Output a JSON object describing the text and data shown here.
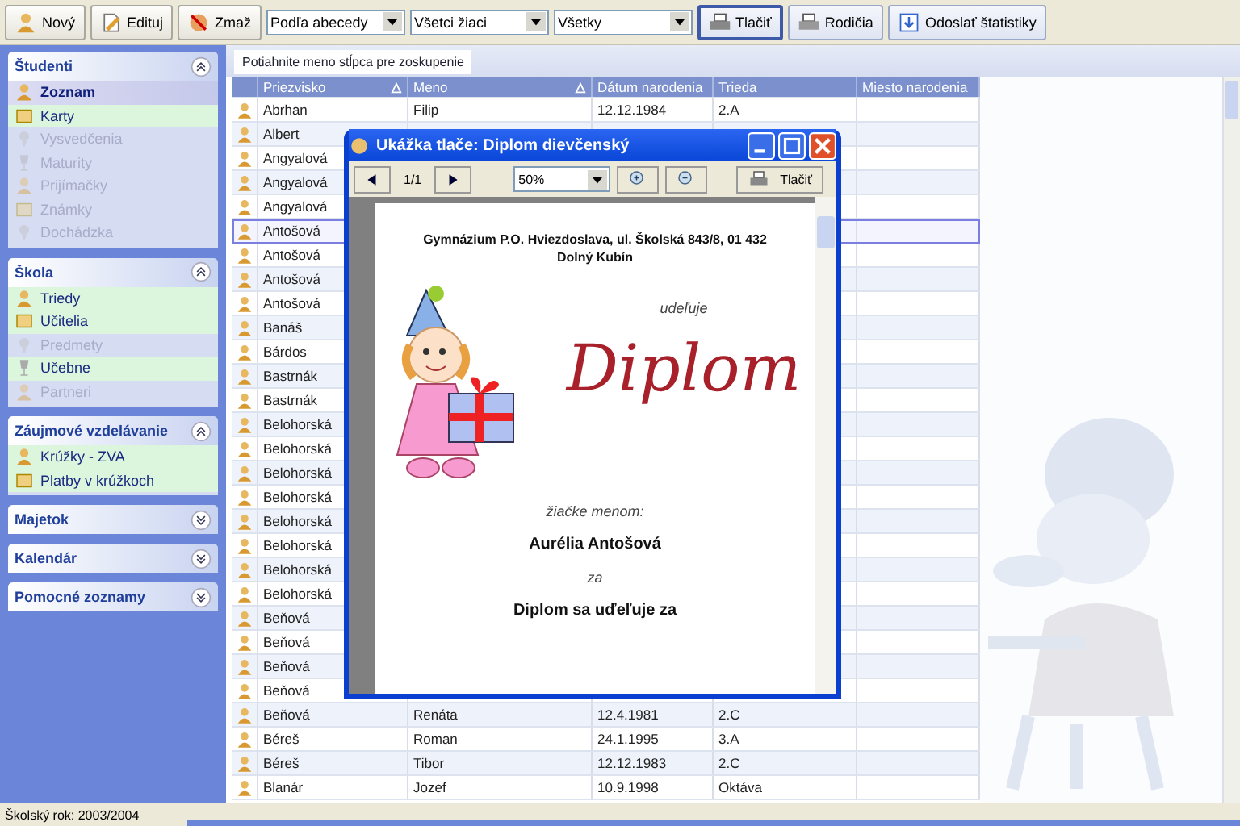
{
  "toolbar": {
    "buttons": [
      {
        "label": "Nový",
        "kind": "new"
      },
      {
        "label": "Edituj",
        "kind": "edit"
      },
      {
        "label": "Zmaž",
        "kind": "delete"
      }
    ],
    "dropdowns": [
      {
        "value": "Podľa abecedy"
      },
      {
        "value": "Všetci žiaci"
      },
      {
        "value": "Všetky"
      }
    ],
    "actions": [
      {
        "label": "Tlačiť",
        "kind": "print",
        "selected": true
      },
      {
        "label": "Rodičia",
        "kind": "parents",
        "selected": false
      },
      {
        "label": "Odoslať štatistiky",
        "kind": "stats",
        "selected": false
      }
    ]
  },
  "sidebar": {
    "panels": [
      {
        "title": "Študenti",
        "expanded": true,
        "items": [
          {
            "label": "Zoznam",
            "selected": true,
            "disabled": false
          },
          {
            "label": "Karty",
            "selected": false,
            "disabled": false
          },
          {
            "label": "Vysvedčenia",
            "selected": false,
            "disabled": true
          },
          {
            "label": "Maturity",
            "selected": false,
            "disabled": true
          },
          {
            "label": "Prijímačky",
            "selected": false,
            "disabled": true
          },
          {
            "label": "Známky",
            "selected": false,
            "disabled": true
          },
          {
            "label": "Dochádzka",
            "selected": false,
            "disabled": true
          }
        ]
      },
      {
        "title": "Škola",
        "expanded": true,
        "items": [
          {
            "label": "Triedy",
            "selected": false,
            "disabled": false
          },
          {
            "label": "Učitelia",
            "selected": false,
            "disabled": false
          },
          {
            "label": "Predmety",
            "selected": false,
            "disabled": true
          },
          {
            "label": "Učebne",
            "selected": false,
            "disabled": false
          },
          {
            "label": "Partneri",
            "selected": false,
            "disabled": true
          }
        ]
      },
      {
        "title": "Záujmové vzdelávanie",
        "expanded": true,
        "items": [
          {
            "label": "Krúžky - ZVA",
            "selected": false,
            "disabled": false
          },
          {
            "label": "Platby v krúžkoch",
            "selected": false,
            "disabled": false
          }
        ]
      },
      {
        "title": "Majetok",
        "expanded": false
      },
      {
        "title": "Kalendár",
        "expanded": false
      },
      {
        "title": "Pomocné zoznamy",
        "expanded": false
      }
    ]
  },
  "group_panel": {
    "hint": "Potiahnite meno stĺpca pre zoskupenie"
  },
  "table": {
    "columns": [
      {
        "label": "Priezvisko",
        "sorted": true
      },
      {
        "label": "Meno",
        "sorted": true
      },
      {
        "label": "Dátum narodenia",
        "sorted": false
      },
      {
        "label": "Trieda",
        "sorted": false
      },
      {
        "label": "Miesto narodenia",
        "sorted": false
      }
    ],
    "rows": [
      {
        "surname": "Abrhan",
        "name": "Filip",
        "birth_date": "12.12.1984",
        "class": "2.A",
        "selected": false
      },
      {
        "surname": "Albert",
        "selected": false
      },
      {
        "surname": "Angyalová",
        "selected": false
      },
      {
        "surname": "Angyalová",
        "selected": false
      },
      {
        "surname": "Angyalová",
        "selected": false
      },
      {
        "surname": "Antošová",
        "selected": true
      },
      {
        "surname": "Antošová",
        "selected": false
      },
      {
        "surname": "Antošová",
        "selected": false
      },
      {
        "surname": "Antošová",
        "selected": false
      },
      {
        "surname": "Banáš",
        "selected": false
      },
      {
        "surname": "Bárdos",
        "selected": false
      },
      {
        "surname": "Bastrnák",
        "selected": false
      },
      {
        "surname": "Bastrnák",
        "selected": false
      },
      {
        "surname": "Belohorská",
        "selected": false
      },
      {
        "surname": "Belohorská",
        "selected": false
      },
      {
        "surname": "Belohorská",
        "selected": false
      },
      {
        "surname": "Belohorská",
        "selected": false
      },
      {
        "surname": "Belohorská",
        "selected": false
      },
      {
        "surname": "Belohorská",
        "selected": false
      },
      {
        "surname": "Belohorská",
        "selected": false
      },
      {
        "surname": "Belohorská",
        "selected": false
      },
      {
        "surname": "Beňová",
        "selected": false
      },
      {
        "surname": "Beňová",
        "selected": false
      },
      {
        "surname": "Beňová",
        "selected": false
      },
      {
        "surname": "Beňová",
        "selected": false
      },
      {
        "surname": "Beňová",
        "name": "Renáta",
        "birth_date": "12.4.1981",
        "class": "2.C",
        "selected": false
      },
      {
        "surname": "Béreš",
        "name": "Roman",
        "birth_date": "24.1.1995",
        "class": "3.A",
        "selected": false
      },
      {
        "surname": "Béreš",
        "name": "Tibor",
        "birth_date": "12.12.1983",
        "class": "2.C",
        "selected": false
      },
      {
        "surname": "Blanár",
        "name": "Jozef",
        "birth_date": "10.9.1998",
        "class": "Oktáva",
        "selected": false
      }
    ]
  },
  "dialog": {
    "title": "Ukážka tlače: Diplom dievčenský",
    "page": "1/1",
    "zoom": "50%",
    "print_label": "Tlačiť",
    "document": {
      "school": "Gymnázium P.O. Hviezdoslava, ul. Školská 843/8, 01 432",
      "town": "Dolný Kubín",
      "awards": "udeľuje",
      "heading": "Diplom",
      "to_label": "žiačke menom:",
      "student": "Aurélia Antošová",
      "for_label": "za",
      "reason": "Diplom sa uďeľuje za"
    }
  },
  "status_bar": {
    "school_year": "Školský rok: 2003/2004"
  }
}
